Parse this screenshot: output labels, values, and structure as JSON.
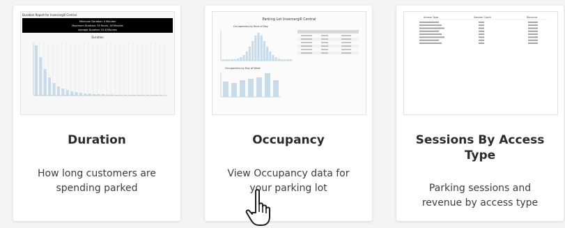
{
  "cards": [
    {
      "title": "Duration",
      "description": "How long customers are spending parked",
      "thumbnail": {
        "report_title": "Duration Report for Invercargill Central",
        "header_lines": [
          "Minimum Duration: 0 Minutes",
          "Maximum Duration: 35 Hours, 16 Minutes",
          "Average Duration: 55.8 Minutes"
        ],
        "chart_title": "Duration"
      }
    },
    {
      "title": "Occupancy",
      "description": "View Occupancy data for your parking lot",
      "thumbnail": {
        "report_title": "Parking Lot Invercargill Central",
        "chart1_title": "Occupancies by Hour of Day",
        "chart2_title": "Occupancies by Day of Week"
      }
    },
    {
      "title": "Sessions By Access Type",
      "description": "Parking sessions and revenue by access type",
      "thumbnail": {
        "columns": [
          "Access Type",
          "Session Count",
          "Revenue"
        ]
      }
    }
  ],
  "cursor": "hand-pointer"
}
